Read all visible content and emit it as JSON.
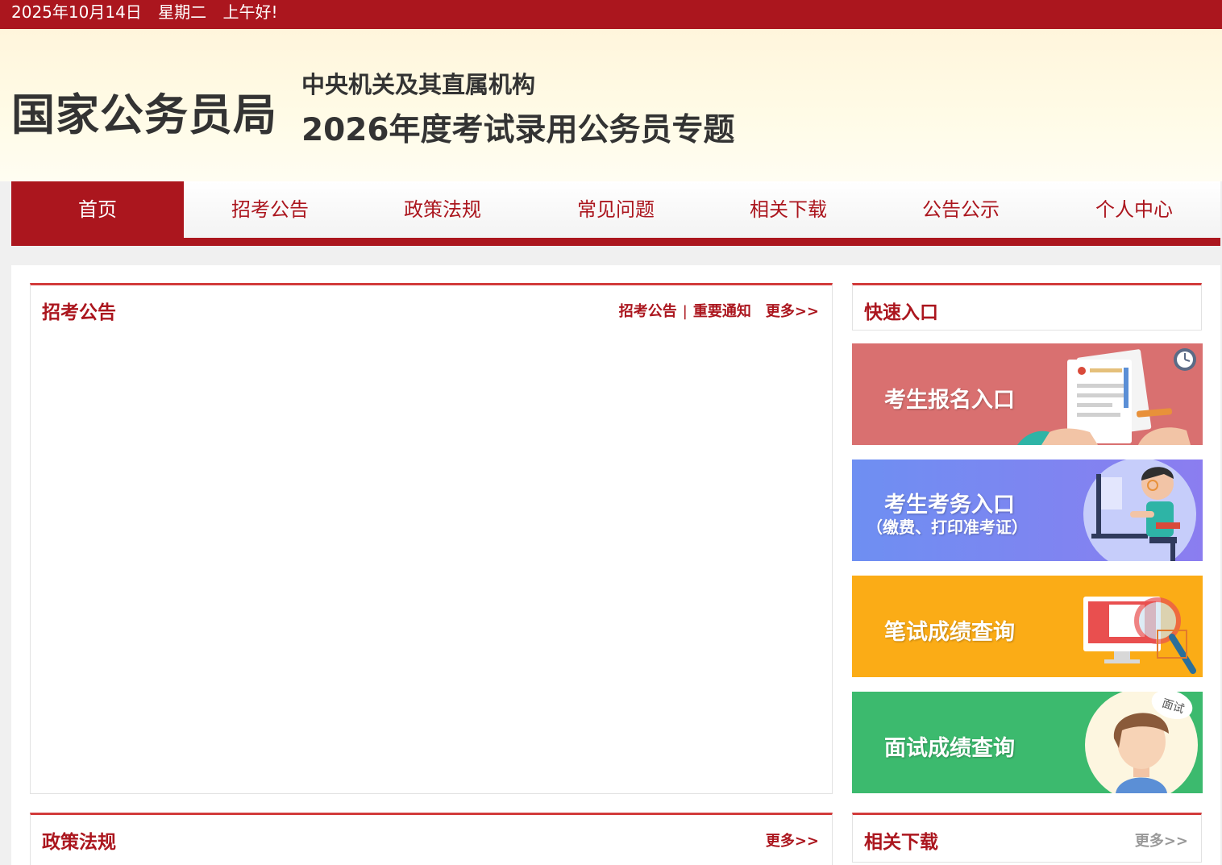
{
  "topbar": {
    "date": "2025年10月14日",
    "weekday": "星期二",
    "greeting": "上午好!"
  },
  "header": {
    "site_name": "国家公务员局",
    "subtitle_1": "中央机关及其直属机构",
    "subtitle_2": "2026年度考试录用公务员专题"
  },
  "nav": {
    "items": [
      {
        "label": "首页",
        "active": true
      },
      {
        "label": "招考公告"
      },
      {
        "label": "政策法规"
      },
      {
        "label": "常见问题"
      },
      {
        "label": "相关下载"
      },
      {
        "label": "公告公示"
      },
      {
        "label": "个人中心"
      }
    ]
  },
  "announcements": {
    "title": "招考公告",
    "link_1": "招考公告",
    "separator": "|",
    "link_2": "重要通知",
    "more": "更多>>"
  },
  "quick": {
    "title": "快速入口",
    "buttons": [
      {
        "label": "考生报名入口",
        "color": "#d97070"
      },
      {
        "label": "考生考务入口",
        "sublabel": "（缴费、打印准考证）",
        "color": "#7a86f0"
      },
      {
        "label": "笔试成绩查询",
        "color": "#fbac16"
      },
      {
        "label": "面试成绩查询",
        "color": "#3cba6e"
      }
    ],
    "badge_text": "面试"
  },
  "policy": {
    "title": "政策法规",
    "more": "更多>>"
  },
  "downloads": {
    "title": "相关下载",
    "more": "更多>>"
  },
  "colors": {
    "brand_red": "#ab161e",
    "accent_red": "#d23b3b"
  }
}
